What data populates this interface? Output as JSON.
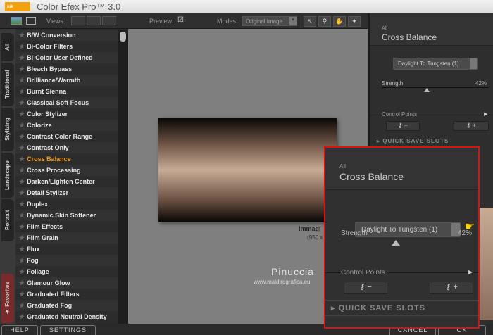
{
  "app": {
    "title": "Color Efex Pro™ 3.0",
    "logo": "nik software"
  },
  "toolbar": {
    "views_label": "Views:",
    "preview_label": "Preview:",
    "preview_checked": true,
    "modes_label": "Modes:",
    "mode_value": "Original Image",
    "tools": [
      "arrow-icon",
      "zoom-icon",
      "hand-icon",
      "light-icon"
    ]
  },
  "tabs": [
    "All",
    "Traditional",
    "Stylizing",
    "Landscape",
    "Portrait",
    "Favorites"
  ],
  "filters": [
    "B/W Conversion",
    "Bi-Color Filters",
    "Bi-Color User Defined",
    "Bleach Bypass",
    "Brilliance/Warmth",
    "Burnt Sienna",
    "Classical Soft Focus",
    "Color Stylizer",
    "Colorize",
    "Contrast Color Range",
    "Contrast Only",
    "Cross Balance",
    "Cross Processing",
    "Darken/Lighten Center",
    "Detail Stylizer",
    "Duplex",
    "Dynamic Skin Softener",
    "Film Effects",
    "Film Grain",
    "Flux",
    "Fog",
    "Foliage",
    "Glamour Glow",
    "Graduated Filters",
    "Graduated Fog",
    "Graduated Neutral Density"
  ],
  "selected_filter": "Cross Balance",
  "preview": {
    "image_name": "Immagi",
    "image_size": "(950 x",
    "watermark_name": "Pinuccia",
    "watermark_url": "www.maidiregrafica.eu"
  },
  "panel": {
    "category": "All",
    "title": "Cross Balance",
    "preset": "Daylight To Tungsten (1)",
    "strength_label": "Strength",
    "strength_value": "42%",
    "strength": 42,
    "control_points_label": "Control Points",
    "minus": "−",
    "plus": "+",
    "quick_save": "QUICK SAVE SLOTS"
  },
  "bottom": {
    "help": "HELP",
    "settings": "SETTINGS",
    "cancel": "CANCEL",
    "ok": "OK"
  },
  "colors": {
    "accent": "#f39a1c",
    "highlight": "#e01010"
  }
}
